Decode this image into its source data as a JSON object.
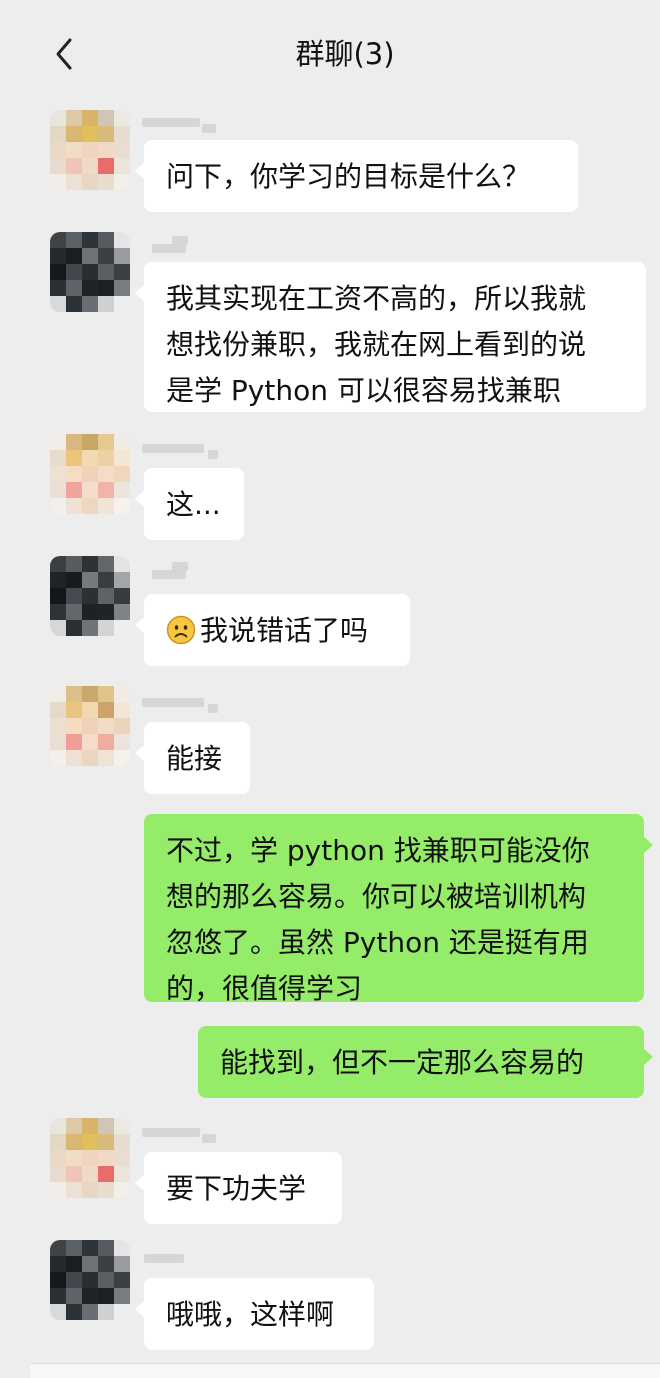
{
  "header": {
    "title": "群聊(3)",
    "back_icon": "chevron-left-icon"
  },
  "colors": {
    "background": "#ededed",
    "bubble_incoming": "#ffffff",
    "bubble_outgoing": "#95ec69"
  },
  "messages": [
    {
      "sender": "user-a",
      "direction": "incoming",
      "text": "问下，你学习的目标是什么？"
    },
    {
      "sender": "user-b",
      "direction": "incoming",
      "text": "我其实现在工资不高的，所以我就\n想找份兼职，我就在网上看到的说\n是学 Python 可以很容易找兼职"
    },
    {
      "sender": "user-c",
      "direction": "incoming",
      "text": "这..."
    },
    {
      "sender": "user-b",
      "direction": "incoming",
      "emoji": "frowning-face-icon",
      "text": "我说错话了吗"
    },
    {
      "sender": "user-c",
      "direction": "incoming",
      "text": "能接"
    },
    {
      "sender": "me",
      "direction": "outgoing",
      "text": "不过，学 python 找兼职可能没你\n想的那么容易。你可以被培训机构\n忽悠了。虽然 Python 还是挺有用\n的，很值得学习"
    },
    {
      "sender": "me",
      "direction": "outgoing",
      "text": "能找到，但不一定那么容易的"
    },
    {
      "sender": "user-a",
      "direction": "incoming",
      "text": "要下功夫学"
    },
    {
      "sender": "user-b",
      "direction": "incoming",
      "text": "哦哦，这样啊"
    }
  ]
}
